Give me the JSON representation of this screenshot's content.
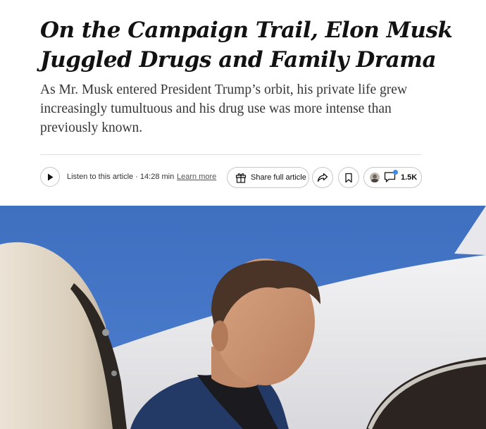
{
  "article": {
    "headline": "On the Campaign Trail, Elon Musk Juggled Drugs and Family Drama",
    "summary": "As Mr. Musk entered President Trump’s orbit, his private life grew increasingly tumultuous and his drug use was more intense than previously known."
  },
  "toolbar": {
    "listen_label": "Listen to this article · 14:28 min",
    "learn_more": "Learn more",
    "share_full_label": "Share full article",
    "comment_count": "1.5K",
    "icons": {
      "play": "play-icon",
      "gift": "gift-icon",
      "share": "share-arrow-icon",
      "bookmark": "bookmark-icon",
      "comment": "comment-icon"
    }
  },
  "colors": {
    "text": "#121212",
    "summary_text": "#363636",
    "border": "#c7c7c7",
    "notification_dot": "#3d8be8"
  }
}
